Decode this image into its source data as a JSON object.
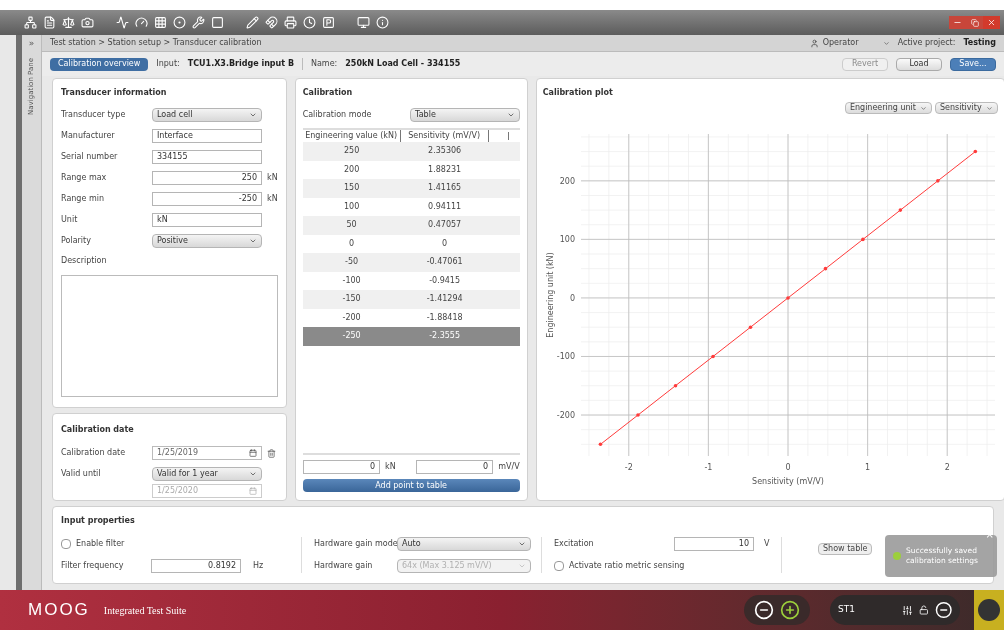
{
  "nav": {
    "toggle": "»",
    "label": "Navigation Pane"
  },
  "breadcrumb": "Test station > Station setup > Transducer calibration",
  "user": {
    "role": "Operator",
    "project_label": "Active project:",
    "project": "Testing"
  },
  "header": {
    "overview_button": "Calibration overview",
    "input_label": "Input:",
    "input": "TCU1.X3.Bridge input B",
    "name_label": "Name:",
    "name": "250kN Load Cell - 334155",
    "buttons": [
      {
        "label": "Revert",
        "kind": "disabled"
      },
      {
        "label": "Load",
        "kind": "normal"
      },
      {
        "label": "Save...",
        "kind": "primary"
      }
    ]
  },
  "transducer": {
    "title": "Transducer information",
    "fields": [
      {
        "kind": "select",
        "label": "Transducer type",
        "value": "Load cell"
      },
      {
        "kind": "text",
        "label": "Manufacturer",
        "value": "Interface"
      },
      {
        "kind": "text",
        "label": "Serial number",
        "value": "334155"
      },
      {
        "kind": "number",
        "label": "Range max",
        "value": "250",
        "unit": "kN"
      },
      {
        "kind": "number",
        "label": "Range min",
        "value": "-250",
        "unit": "kN"
      },
      {
        "kind": "text",
        "label": "Unit",
        "value": "kN"
      },
      {
        "kind": "select",
        "label": "Polarity",
        "value": "Positive"
      }
    ],
    "description_label": "Description"
  },
  "calibration_date": {
    "title": "Calibration date",
    "date_label": "Calibration date",
    "date": "1/25/2019",
    "valid_label": "Valid until",
    "valid_option": "Valid for 1 year",
    "valid_date": "1/25/2020"
  },
  "calibration": {
    "title": "Calibration",
    "mode_label": "Calibration mode",
    "mode": "Table",
    "columns": [
      "Engineering value (kN)",
      "Sensitivity (mV/V)"
    ],
    "rows": [
      {
        "cells": [
          "250",
          "2.35306"
        ],
        "selected": false
      },
      {
        "cells": [
          "200",
          "1.88231"
        ],
        "selected": false
      },
      {
        "cells": [
          "150",
          "1.41165"
        ],
        "selected": false
      },
      {
        "cells": [
          "100",
          "0.94111"
        ],
        "selected": false
      },
      {
        "cells": [
          "50",
          "0.47057"
        ],
        "selected": false
      },
      {
        "cells": [
          "0",
          "0"
        ],
        "selected": false
      },
      {
        "cells": [
          "-50",
          "-0.47061"
        ],
        "selected": false
      },
      {
        "cells": [
          "-100",
          "-0.9415"
        ],
        "selected": false
      },
      {
        "cells": [
          "-150",
          "-1.41294"
        ],
        "selected": false
      },
      {
        "cells": [
          "-200",
          "-1.88418"
        ],
        "selected": false
      },
      {
        "cells": [
          "-250",
          "-2.3555"
        ],
        "selected": true
      }
    ],
    "entry": {
      "value1": "0",
      "unit1": "kN",
      "value2": "0",
      "unit2": "mV/V"
    },
    "add_button": "Add point to table"
  },
  "plot": {
    "title": "Calibration plot",
    "dropdowns": [
      "Engineering unit",
      "Sensitivity"
    ],
    "chart_data": {
      "type": "line",
      "xlabel": "Sensitivity (mV/V)",
      "ylabel": "Engineering unit (kN)",
      "x": [
        2.35306,
        1.88231,
        1.41165,
        0.94111,
        0.47057,
        0,
        -0.47061,
        -0.9415,
        -1.41294,
        -1.88418,
        -2.3555
      ],
      "grid": true,
      "series": [
        {
          "color": "#ff3b3b",
          "values": [
            250,
            200,
            150,
            100,
            50,
            0,
            -50,
            -100,
            -150,
            -200,
            -250
          ]
        }
      ],
      "xlim": [
        -2.6,
        2.6
      ],
      "ylim": [
        -270,
        280
      ],
      "xticks": [
        -2,
        -1,
        0,
        1,
        2
      ],
      "yticks": [
        -200,
        -100,
        0,
        100,
        200
      ]
    }
  },
  "input_properties": {
    "title": "Input properties",
    "enable_filter": {
      "label": "Enable filter",
      "checked": false
    },
    "filter_frequency": {
      "label": "Filter frequency",
      "value": "0.8192",
      "unit": "Hz"
    },
    "gain_mode": {
      "label": "Hardware gain mode",
      "value": "Auto"
    },
    "gain": {
      "label": "Hardware gain",
      "value": "64x (Max 3.125 mV/V)",
      "disabled": true
    },
    "excitation": {
      "label": "Excitation",
      "value": "10",
      "unit": "V"
    },
    "ratio_metric": {
      "label": "Activate ratio metric sensing",
      "checked": false
    },
    "show_table": "Show table"
  },
  "toast": {
    "message": "Successfully saved calibration settings",
    "close": "×"
  },
  "footer": {
    "brand": "MOOG",
    "product": "Integrated Test Suite",
    "station": "ST1"
  }
}
